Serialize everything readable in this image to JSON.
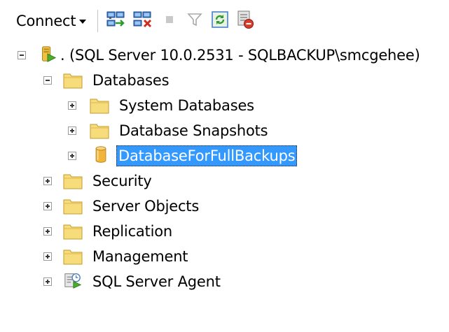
{
  "toolbar": {
    "connect_label": "Connect",
    "buttons": [
      {
        "icon": "connect-object-explorer-icon"
      },
      {
        "icon": "disconnect-icon"
      },
      {
        "icon": "stop-icon"
      },
      {
        "icon": "filter-icon"
      },
      {
        "icon": "refresh-icon"
      },
      {
        "icon": "disable-object-explorer-icon"
      }
    ]
  },
  "tree": {
    "server": {
      "label": ". (SQL Server 10.0.2531 - SQLBACKUP\\smcgehee)",
      "icon": "server-icon",
      "expanded": true
    },
    "databases": {
      "label": "Databases",
      "icon": "folder-icon",
      "expanded": true,
      "children": [
        {
          "label": "System Databases",
          "icon": "folder-icon",
          "expanded": false
        },
        {
          "label": "Database Snapshots",
          "icon": "folder-icon",
          "expanded": false
        },
        {
          "label": "DatabaseForFullBackups",
          "icon": "database-icon",
          "expanded": false,
          "selected": true
        }
      ]
    },
    "top_level": [
      {
        "label": "Security",
        "icon": "folder-icon",
        "expanded": false
      },
      {
        "label": "Server Objects",
        "icon": "folder-icon",
        "expanded": false
      },
      {
        "label": "Replication",
        "icon": "folder-icon",
        "expanded": false
      },
      {
        "label": "Management",
        "icon": "folder-icon",
        "expanded": false
      },
      {
        "label": "SQL Server Agent",
        "icon": "sql-agent-icon",
        "expanded": false
      }
    ]
  },
  "colors": {
    "selection": "#3399ff",
    "folder": "#f4d36a",
    "database": "#f2b53a",
    "server_green": "#4caf2a"
  }
}
